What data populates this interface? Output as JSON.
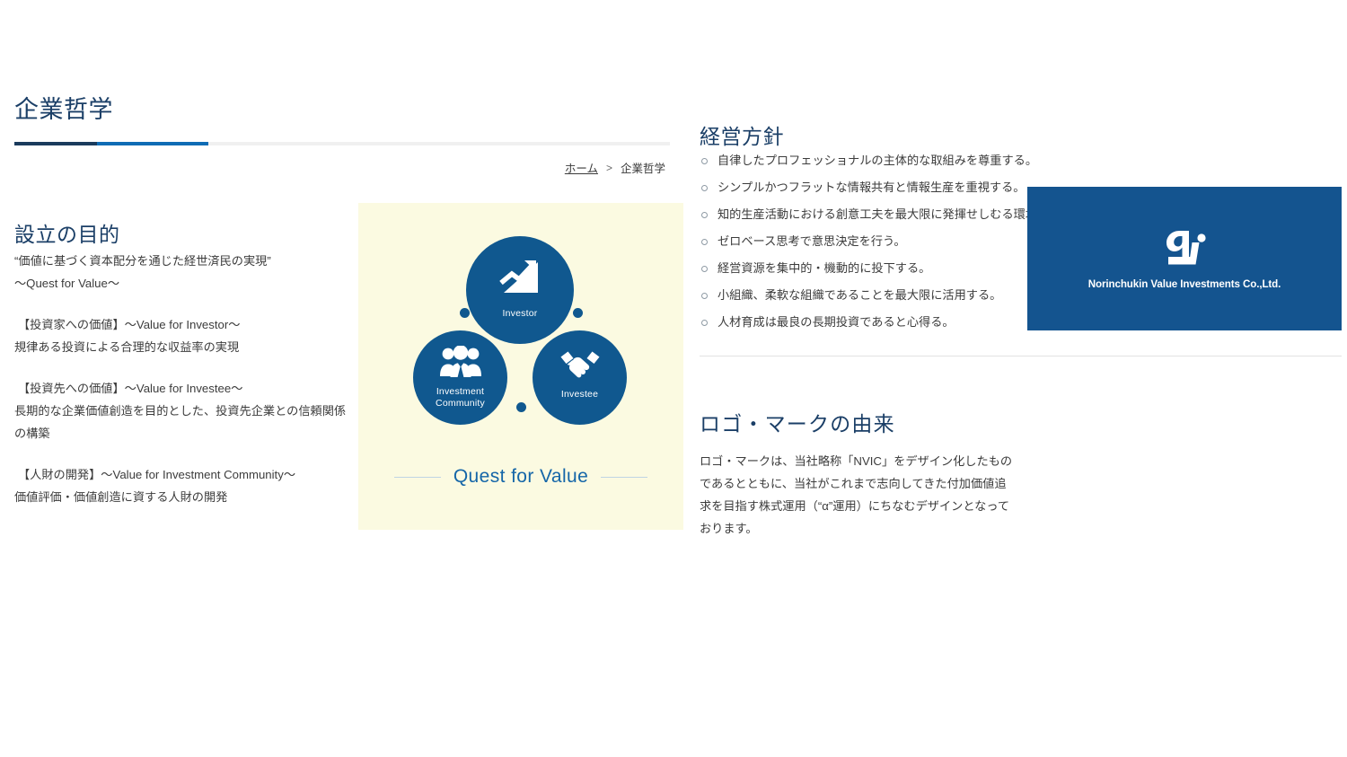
{
  "page": {
    "title": "企業哲学"
  },
  "breadcrumb": {
    "home_label": "ホーム",
    "separator": ">",
    "current_label": "企業哲学"
  },
  "purpose": {
    "heading": "設立の目的",
    "blocks": [
      {
        "lines": [
          "“価値に基づく資本配分を通じた経世済民の実現”",
          "〜Quest for Value〜"
        ]
      },
      {
        "lines": [
          "【投資家への価値】〜Value for Investor〜",
          "規律ある投資による合理的な収益率の実現"
        ]
      },
      {
        "lines": [
          "【投資先への価値】〜Value for Investee〜",
          "長期的な企業価値創造を目的とした、投資先企業との信頼関係の構築"
        ]
      },
      {
        "lines": [
          "【人財の開発】〜Value for Investment Community〜",
          "価値評価・価値創造に資する人財の開発"
        ]
      }
    ]
  },
  "diagram": {
    "caption": "Quest for Value",
    "nodes": [
      {
        "id": "investor",
        "label": "Investor",
        "icon": "growth-chart-icon"
      },
      {
        "id": "community",
        "label_line1": "Investment",
        "label_line2": "Community",
        "icon": "people-group-icon"
      },
      {
        "id": "investee",
        "label": "Investee",
        "icon": "handshake-icon"
      }
    ],
    "background_color": "#fbfae1",
    "node_color": "#10588f",
    "caption_color": "#1566a8"
  },
  "policy": {
    "heading": "経営方針",
    "items": [
      "自律したプロフェッショナルの主体的な取組みを尊重する。",
      "シンプルかつフラットな情報共有と情報生産を重視する。",
      "知的生産活動における創意工夫を最大限に発揮せしむる環境を整備する。",
      "ゼロベース思考で意思決定を行う。",
      "経営資源を集中的・機動的に投下する。",
      "小組織、柔軟な組織であることを最大限に活用する。",
      "人材育成は最良の長期投資であると心得る。"
    ]
  },
  "logo_section": {
    "heading": "ロゴ・マークの由来",
    "body": "ロゴ・マークは、当社略称「NVIC」をデザイン化したものであるとともに、当社がこれまで志向してきた付加価値追求を目指す株式運用（“α”運用）にちなむデザインとなっております。",
    "company_name": "Norinchukin Value Investments Co.,Ltd.",
    "box_color": "#14548f"
  },
  "theme": {
    "heading_navy": "#1b3f67",
    "rule_navy": "#1a3b5c",
    "rule_blue": "#0f6cb5",
    "rule_gray": "#f0f0f0",
    "body_text": "#3c3c3c"
  }
}
